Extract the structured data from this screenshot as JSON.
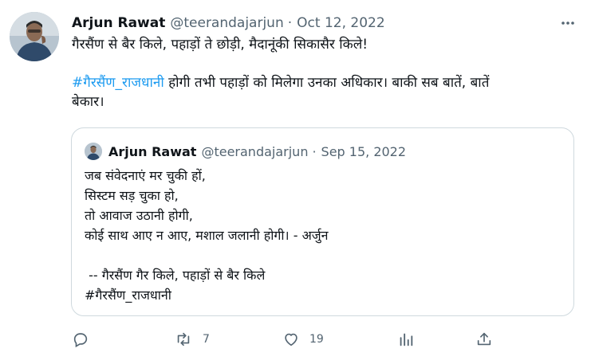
{
  "tweet": {
    "author_name": "Arjun Rawat",
    "author_handle": "@teerandajarjun",
    "separator": "·",
    "date": "Oct 12, 2022",
    "line1": "गैरसैंण से बैर किले, पहाड़ों ते छोड़ी, मैदानूंकी सिकासैर किले!",
    "hashtag": "#गैरसैंण_राजधानी",
    "line2_rest": " होगी तभी पहाड़ों को मिलेगा उनका अधिकार। बाकी सब बातें, बातें",
    "line3": "बेकार।",
    "more_icon": "more-horizontal-icon"
  },
  "quoted": {
    "author_name": "Arjun Rawat",
    "author_handle": "@teerandajarjun",
    "separator": "·",
    "date": "Sep 15, 2022",
    "lines": [
      "जब संवेदनाएं मर चुकी हों,",
      "सिस्टम सड़ चुका हो,",
      "तो आवाज उठानी होगी,",
      "कोई साथ आए न आए, मशाल जलानी होगी। - अर्जुन",
      "",
      " -- गैरसैंण गैर किले, पहाड़ों से बैर किले",
      "#गैरसैंण_राजधानी"
    ]
  },
  "actions": {
    "reply_icon": "reply-icon",
    "retweet_icon": "retweet-icon",
    "retweet_count": "7",
    "like_icon": "heart-icon",
    "like_count": "19",
    "views_icon": "analytics-icon",
    "share_icon": "share-icon"
  },
  "colors": {
    "text": "#0f1419",
    "secondary": "#536471",
    "link": "#1d9bf0",
    "border": "#cfd9de"
  }
}
